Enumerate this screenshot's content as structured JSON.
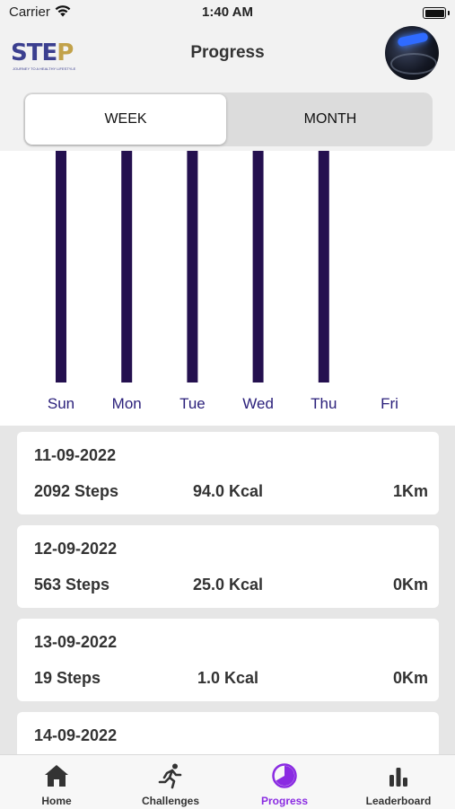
{
  "status_bar": {
    "carrier": "Carrier",
    "time": "1:40 AM"
  },
  "header": {
    "title": "Progress",
    "logo_text": "STEP",
    "logo_tagline": "JOURNEY TO A HEALTHY LIFESTYLE"
  },
  "segment": {
    "week_label": "WEEK",
    "month_label": "MONTH",
    "selected": "WEEK"
  },
  "colors": {
    "bar": "#24104f",
    "active_tab": "#8a2be2",
    "tick": "#2a1f7a"
  },
  "chart_data": {
    "type": "bar",
    "categories": [
      "Sun",
      "Mon",
      "Tue",
      "Wed",
      "Thu",
      "Fri"
    ],
    "values": [
      1,
      1,
      1,
      1,
      1,
      0
    ],
    "ylim": [
      0,
      1
    ],
    "title": "",
    "xlabel": "",
    "ylabel": "",
    "grid": false
  },
  "entries": [
    {
      "date": "11-09-2022",
      "steps": "2092 Steps",
      "kcal": "94.0 Kcal",
      "distance": "1Km"
    },
    {
      "date": "12-09-2022",
      "steps": "563 Steps",
      "kcal": "25.0 Kcal",
      "distance": "0Km"
    },
    {
      "date": "13-09-2022",
      "steps": "19 Steps",
      "kcal": "1.0 Kcal",
      "distance": "0Km"
    },
    {
      "date": "14-09-2022",
      "steps": "",
      "kcal": "",
      "distance": ""
    }
  ],
  "tabs": [
    {
      "label": "Home",
      "icon": "home-icon",
      "active": false
    },
    {
      "label": "Challenges",
      "icon": "running-icon",
      "active": false
    },
    {
      "label": "Progress",
      "icon": "progress-icon",
      "active": true
    },
    {
      "label": "Leaderboard",
      "icon": "leaderboard-icon",
      "active": false
    }
  ]
}
